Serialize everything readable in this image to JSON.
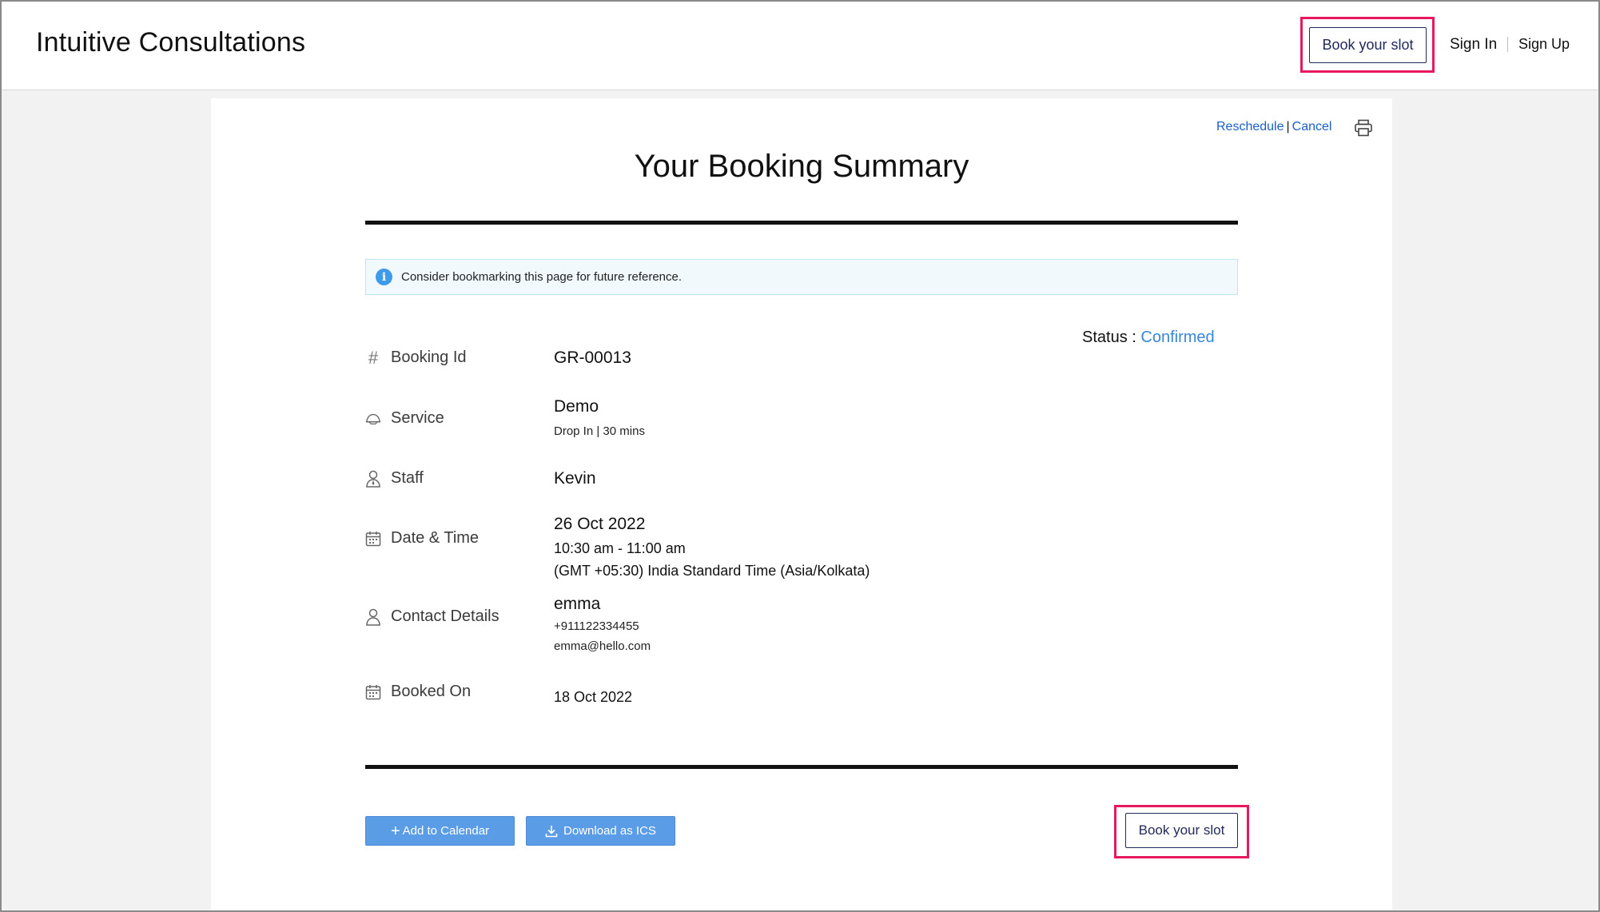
{
  "header": {
    "brand": "Intuitive Consultations",
    "book_slot_label": "Book your slot",
    "sign_in": "Sign In",
    "sign_up": "Sign Up"
  },
  "summary": {
    "reschedule": "Reschedule",
    "link_separator": "|",
    "cancel": "Cancel",
    "title": "Your Booking Summary",
    "info_icon_glyph": "i",
    "info_text": "Consider bookmarking this page for future reference.",
    "status_label": "Status :",
    "status_value": "Confirmed",
    "status_color": "#3a86d9"
  },
  "rows": [
    {
      "label": "Booking Id",
      "icon": "hash-icon",
      "icon_glyph": "#",
      "values": [
        "GR-00013"
      ]
    },
    {
      "label": "Service",
      "icon": "service-icon",
      "values": [
        "Demo",
        "Drop In | 30 mins"
      ]
    },
    {
      "label": "Staff",
      "icon": "staff-icon",
      "values": [
        "Kevin"
      ]
    },
    {
      "label": "Date & Time",
      "icon": "calendar-icon",
      "values": [
        "26 Oct 2022",
        "10:30 am - 11:00 am",
        "(GMT +05:30) India Standard Time (Asia/Kolkata)"
      ]
    },
    {
      "label": "Contact Details",
      "icon": "user-icon",
      "values": [
        "emma",
        "+911122334455",
        "emma@hello.com"
      ]
    },
    {
      "label": "Booked On",
      "icon": "calendar-icon",
      "values": [
        "18 Oct 2022"
      ]
    }
  ],
  "actions": {
    "add_calendar_plus": "+",
    "add_calendar": "Add to Calendar",
    "download_ics": "Download as ICS",
    "book_slot_label": "Book your slot",
    "primary_color": "#5b9ce6",
    "highlight_color": "#e8185f"
  }
}
